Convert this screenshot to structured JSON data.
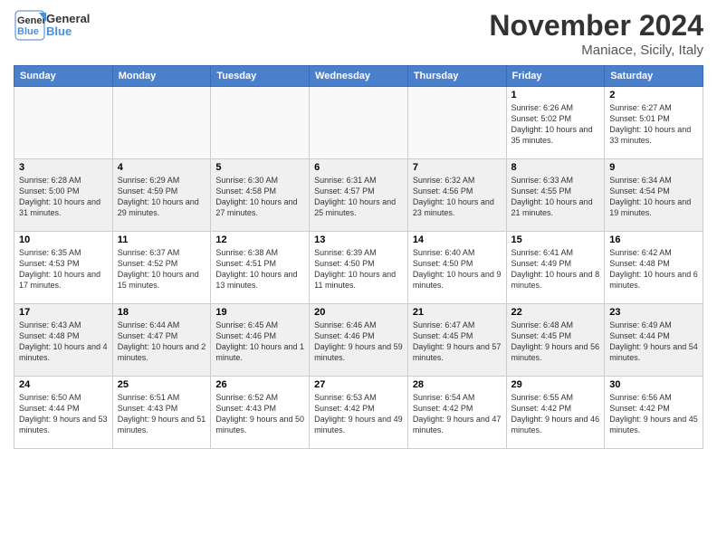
{
  "header": {
    "logo_line1": "General",
    "logo_line2": "Blue",
    "month": "November 2024",
    "location": "Maniace, Sicily, Italy"
  },
  "weekdays": [
    "Sunday",
    "Monday",
    "Tuesday",
    "Wednesday",
    "Thursday",
    "Friday",
    "Saturday"
  ],
  "rows": [
    {
      "cells": [
        {
          "empty": true
        },
        {
          "empty": true
        },
        {
          "empty": true
        },
        {
          "empty": true
        },
        {
          "empty": true
        },
        {
          "day": 1,
          "sunrise": "6:26 AM",
          "sunset": "5:02 PM",
          "daylight": "10 hours and 35 minutes."
        },
        {
          "day": 2,
          "sunrise": "6:27 AM",
          "sunset": "5:01 PM",
          "daylight": "10 hours and 33 minutes."
        }
      ]
    },
    {
      "cells": [
        {
          "day": 3,
          "sunrise": "6:28 AM",
          "sunset": "5:00 PM",
          "daylight": "10 hours and 31 minutes."
        },
        {
          "day": 4,
          "sunrise": "6:29 AM",
          "sunset": "4:59 PM",
          "daylight": "10 hours and 29 minutes."
        },
        {
          "day": 5,
          "sunrise": "6:30 AM",
          "sunset": "4:58 PM",
          "daylight": "10 hours and 27 minutes."
        },
        {
          "day": 6,
          "sunrise": "6:31 AM",
          "sunset": "4:57 PM",
          "daylight": "10 hours and 25 minutes."
        },
        {
          "day": 7,
          "sunrise": "6:32 AM",
          "sunset": "4:56 PM",
          "daylight": "10 hours and 23 minutes."
        },
        {
          "day": 8,
          "sunrise": "6:33 AM",
          "sunset": "4:55 PM",
          "daylight": "10 hours and 21 minutes."
        },
        {
          "day": 9,
          "sunrise": "6:34 AM",
          "sunset": "4:54 PM",
          "daylight": "10 hours and 19 minutes."
        }
      ]
    },
    {
      "cells": [
        {
          "day": 10,
          "sunrise": "6:35 AM",
          "sunset": "4:53 PM",
          "daylight": "10 hours and 17 minutes."
        },
        {
          "day": 11,
          "sunrise": "6:37 AM",
          "sunset": "4:52 PM",
          "daylight": "10 hours and 15 minutes."
        },
        {
          "day": 12,
          "sunrise": "6:38 AM",
          "sunset": "4:51 PM",
          "daylight": "10 hours and 13 minutes."
        },
        {
          "day": 13,
          "sunrise": "6:39 AM",
          "sunset": "4:50 PM",
          "daylight": "10 hours and 11 minutes."
        },
        {
          "day": 14,
          "sunrise": "6:40 AM",
          "sunset": "4:50 PM",
          "daylight": "10 hours and 9 minutes."
        },
        {
          "day": 15,
          "sunrise": "6:41 AM",
          "sunset": "4:49 PM",
          "daylight": "10 hours and 8 minutes."
        },
        {
          "day": 16,
          "sunrise": "6:42 AM",
          "sunset": "4:48 PM",
          "daylight": "10 hours and 6 minutes."
        }
      ]
    },
    {
      "cells": [
        {
          "day": 17,
          "sunrise": "6:43 AM",
          "sunset": "4:48 PM",
          "daylight": "10 hours and 4 minutes."
        },
        {
          "day": 18,
          "sunrise": "6:44 AM",
          "sunset": "4:47 PM",
          "daylight": "10 hours and 2 minutes."
        },
        {
          "day": 19,
          "sunrise": "6:45 AM",
          "sunset": "4:46 PM",
          "daylight": "10 hours and 1 minute."
        },
        {
          "day": 20,
          "sunrise": "6:46 AM",
          "sunset": "4:46 PM",
          "daylight": "9 hours and 59 minutes."
        },
        {
          "day": 21,
          "sunrise": "6:47 AM",
          "sunset": "4:45 PM",
          "daylight": "9 hours and 57 minutes."
        },
        {
          "day": 22,
          "sunrise": "6:48 AM",
          "sunset": "4:45 PM",
          "daylight": "9 hours and 56 minutes."
        },
        {
          "day": 23,
          "sunrise": "6:49 AM",
          "sunset": "4:44 PM",
          "daylight": "9 hours and 54 minutes."
        }
      ]
    },
    {
      "cells": [
        {
          "day": 24,
          "sunrise": "6:50 AM",
          "sunset": "4:44 PM",
          "daylight": "9 hours and 53 minutes."
        },
        {
          "day": 25,
          "sunrise": "6:51 AM",
          "sunset": "4:43 PM",
          "daylight": "9 hours and 51 minutes."
        },
        {
          "day": 26,
          "sunrise": "6:52 AM",
          "sunset": "4:43 PM",
          "daylight": "9 hours and 50 minutes."
        },
        {
          "day": 27,
          "sunrise": "6:53 AM",
          "sunset": "4:42 PM",
          "daylight": "9 hours and 49 minutes."
        },
        {
          "day": 28,
          "sunrise": "6:54 AM",
          "sunset": "4:42 PM",
          "daylight": "9 hours and 47 minutes."
        },
        {
          "day": 29,
          "sunrise": "6:55 AM",
          "sunset": "4:42 PM",
          "daylight": "9 hours and 46 minutes."
        },
        {
          "day": 30,
          "sunrise": "6:56 AM",
          "sunset": "4:42 PM",
          "daylight": "9 hours and 45 minutes."
        }
      ]
    }
  ]
}
